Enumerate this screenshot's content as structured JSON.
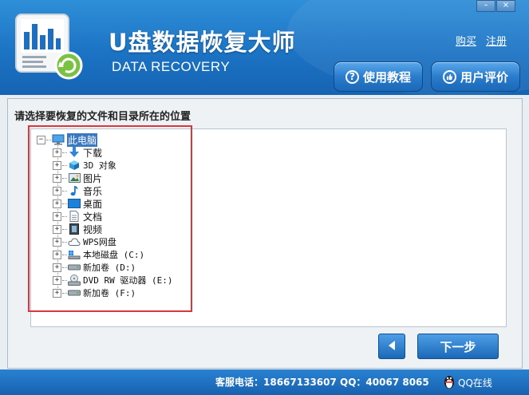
{
  "app": {
    "title_cn": "U盘数据恢复大师",
    "title_en": "DATA RECOVERY",
    "window_controls": {
      "minimize": "–",
      "close": "×"
    }
  },
  "top_links": {
    "buy": "购买",
    "register": "注册"
  },
  "header_buttons": {
    "tutorial": {
      "label": "使用教程",
      "icon": "question-icon"
    },
    "review": {
      "label": "用户评价",
      "icon": "thumb-icon"
    }
  },
  "main": {
    "prompt": "请选择要恢复的文件和目录所在的位置",
    "tree": {
      "root": {
        "label": "此电脑",
        "icon": "computer-icon",
        "expanded": true
      },
      "children": [
        {
          "label": "下载",
          "icon": "download-icon"
        },
        {
          "label": "3D 对象",
          "icon": "cube-icon"
        },
        {
          "label": "图片",
          "icon": "picture-icon"
        },
        {
          "label": "音乐",
          "icon": "music-icon"
        },
        {
          "label": "桌面",
          "icon": "desktop-icon"
        },
        {
          "label": "文档",
          "icon": "document-icon"
        },
        {
          "label": "视频",
          "icon": "video-icon"
        },
        {
          "label": "WPS网盘",
          "icon": "cloud-icon"
        },
        {
          "label": "本地磁盘 (C:)",
          "icon": "windows-drive-icon"
        },
        {
          "label": "新加卷 (D:)",
          "icon": "drive-icon"
        },
        {
          "label": "DVD RW 驱动器 (E:)",
          "icon": "dvd-drive-icon"
        },
        {
          "label": "新加卷 (F:)",
          "icon": "drive-icon"
        }
      ]
    }
  },
  "nav": {
    "back_icon": "arrow-left-icon",
    "next_label": "下一步"
  },
  "footer": {
    "contact_text": "客服电话：18667133607 QQ：40067 8065",
    "qq_label": "QQ在线"
  },
  "colors": {
    "header_blue": "#1c73c4",
    "selection_blue": "#3a78c2",
    "highlight_red": "#d9373d"
  }
}
